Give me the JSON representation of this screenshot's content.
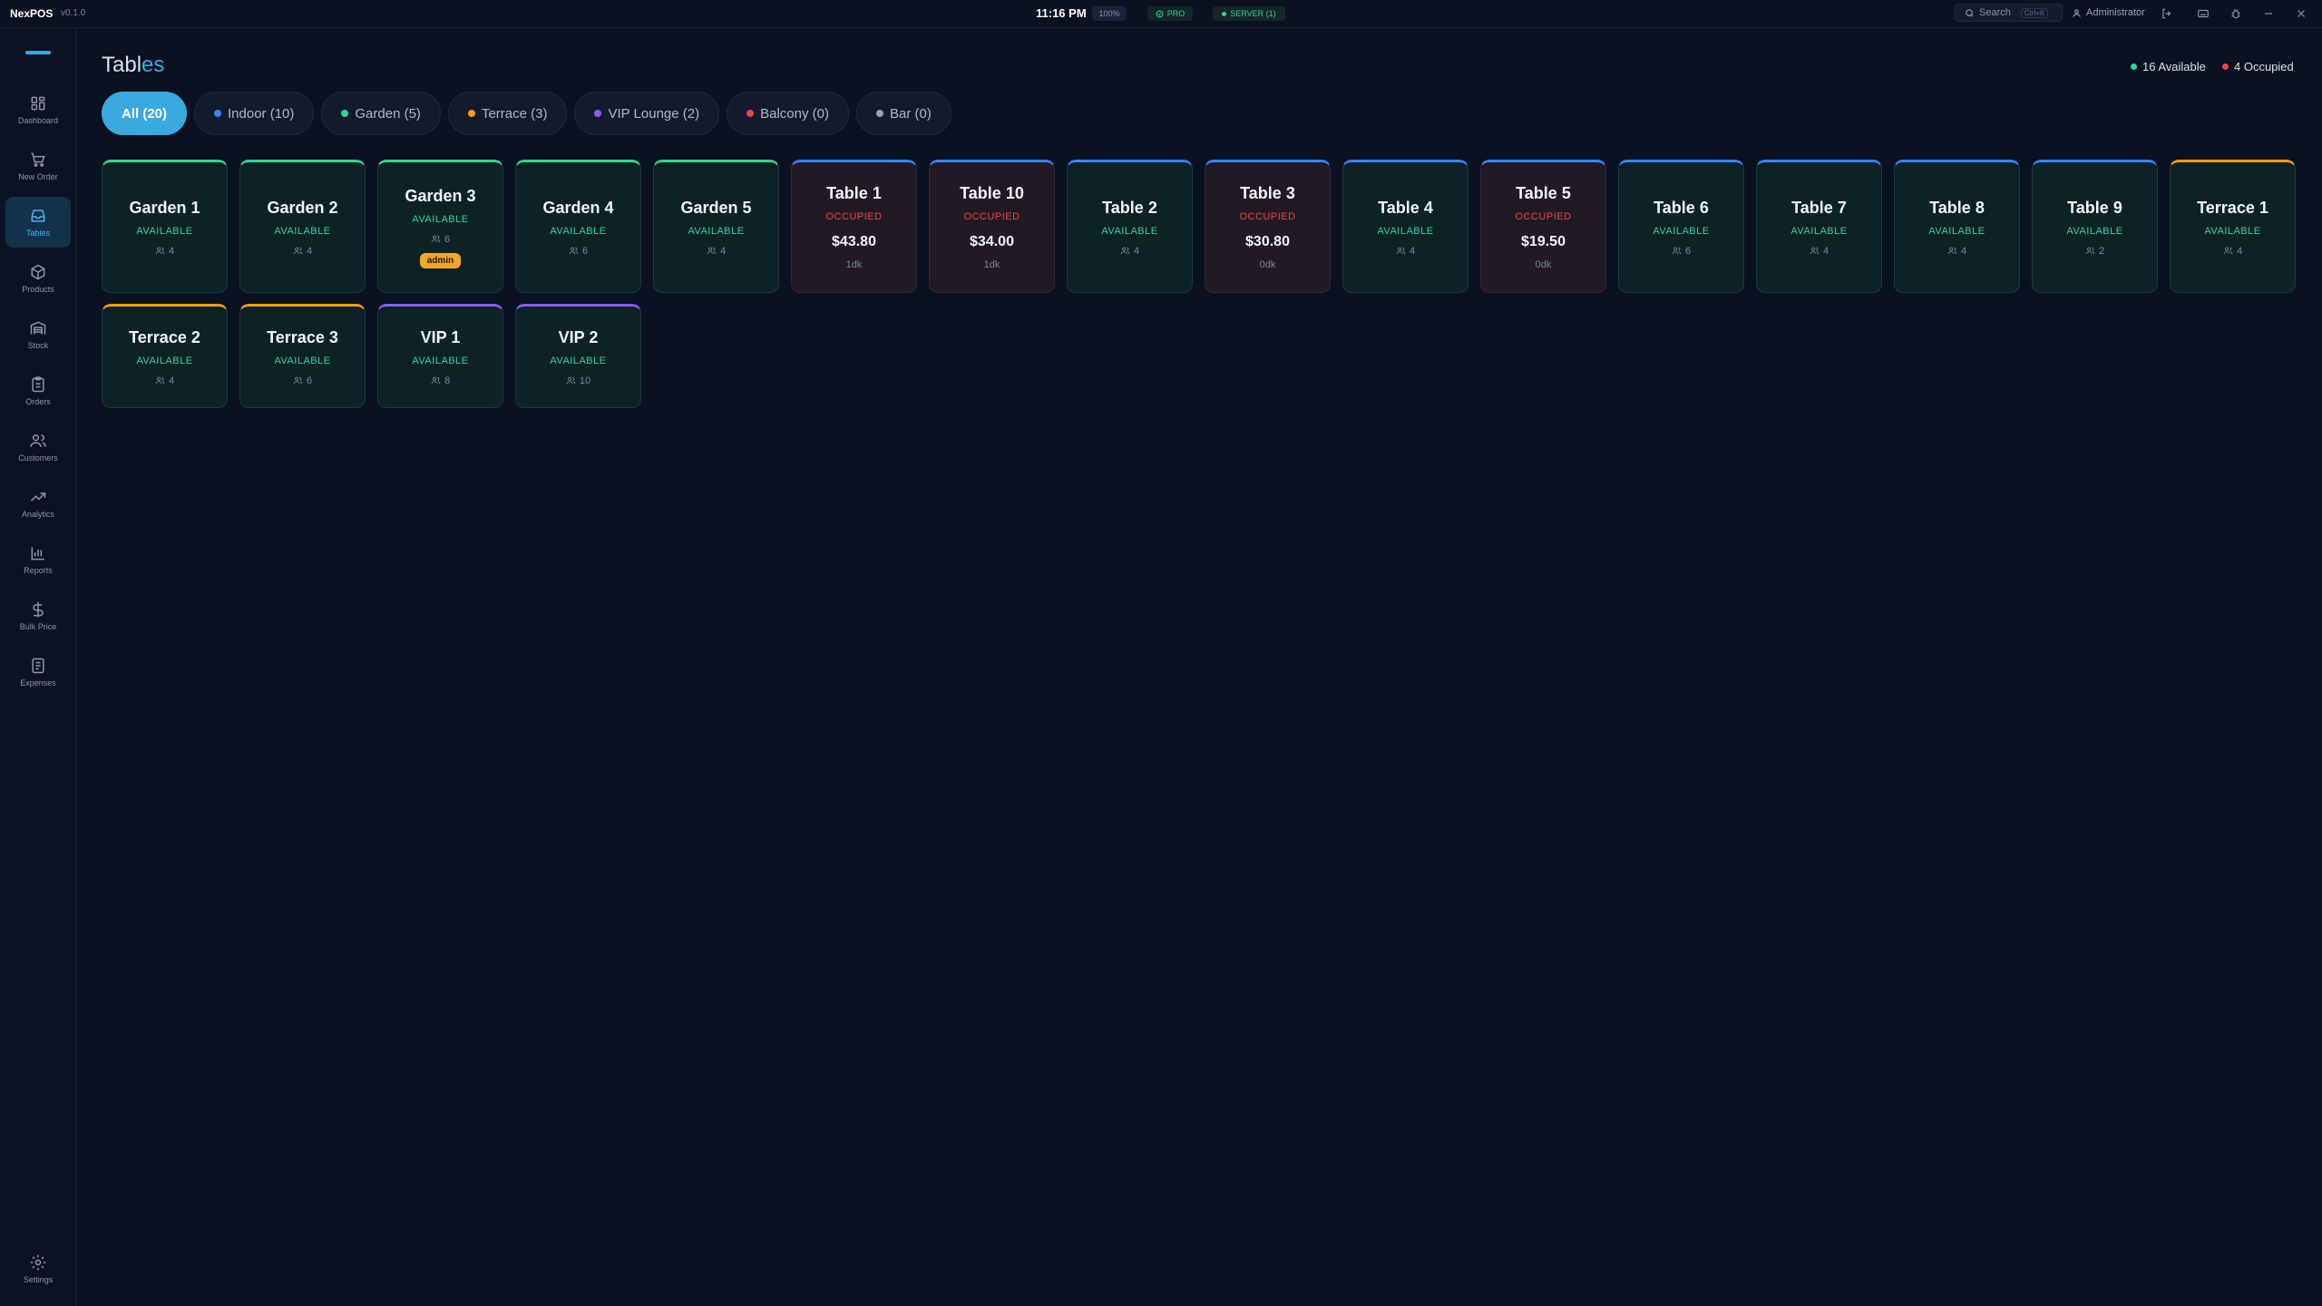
{
  "app": {
    "brand": "NexPOS",
    "version": "v0.1.0",
    "clock": "11:16 PM",
    "zoom": "100%",
    "plan": "PRO",
    "server": "SERVER (1)",
    "search_placeholder": "Search",
    "search_shortcut": "Ctrl+K",
    "user": "Administrator"
  },
  "colors": {
    "accent": "#3aa9df",
    "available": "#34d399",
    "occupied": "#ef4444",
    "indoor": "#3b82f6",
    "garden": "#34d399",
    "terrace": "#f59e0b",
    "vip": "#8b5cf6",
    "balcony": "#ef4444",
    "bar": "#94a3b8"
  },
  "sidebar": {
    "items": [
      {
        "label": "Dashboard",
        "icon": "grid-icon"
      },
      {
        "label": "New Order",
        "icon": "cart-icon"
      },
      {
        "label": "Tables",
        "icon": "tray-icon",
        "active": true
      },
      {
        "label": "Products",
        "icon": "box-icon"
      },
      {
        "label": "Stock",
        "icon": "warehouse-icon"
      },
      {
        "label": "Orders",
        "icon": "clipboard-icon"
      },
      {
        "label": "Customers",
        "icon": "users-icon"
      },
      {
        "label": "Analytics",
        "icon": "trend-icon"
      },
      {
        "label": "Reports",
        "icon": "bar-chart-icon"
      },
      {
        "label": "Bulk Price",
        "icon": "dollar-icon"
      },
      {
        "label": "Expenses",
        "icon": "receipt-icon"
      }
    ],
    "settings_label": "Settings"
  },
  "page": {
    "title_main": "Tabl",
    "title_accent": "es",
    "available_summary": "16 Available",
    "occupied_summary": "4 Occupied"
  },
  "tabs": [
    {
      "label": "All (20)",
      "active": true,
      "color": ""
    },
    {
      "label": "Indoor (10)",
      "color": "#3b82f6"
    },
    {
      "label": "Garden (5)",
      "color": "#34d399"
    },
    {
      "label": "Terrace (3)",
      "color": "#f59e0b"
    },
    {
      "label": "VIP Lounge (2)",
      "color": "#8b5cf6"
    },
    {
      "label": "Balcony (0)",
      "color": "#ef4444"
    },
    {
      "label": "Bar (0)",
      "color": "#94a3b8"
    }
  ],
  "tables": [
    {
      "name": "Garden 1",
      "status": "AVAILABLE",
      "seats": "4",
      "zone": "garden"
    },
    {
      "name": "Garden 2",
      "status": "AVAILABLE",
      "seats": "4",
      "zone": "garden"
    },
    {
      "name": "Garden 3",
      "status": "AVAILABLE",
      "seats": "6",
      "zone": "garden",
      "tag": "admin"
    },
    {
      "name": "Garden 4",
      "status": "AVAILABLE",
      "seats": "6",
      "zone": "garden"
    },
    {
      "name": "Garden 5",
      "status": "AVAILABLE",
      "seats": "4",
      "zone": "garden"
    },
    {
      "name": "Table 1",
      "status": "OCCUPIED",
      "amount": "$43.80",
      "time": "1dk",
      "zone": "indoor"
    },
    {
      "name": "Table 10",
      "status": "OCCUPIED",
      "amount": "$34.00",
      "time": "1dk",
      "zone": "indoor"
    },
    {
      "name": "Table 2",
      "status": "AVAILABLE",
      "seats": "4",
      "zone": "indoor"
    },
    {
      "name": "Table 3",
      "status": "OCCUPIED",
      "amount": "$30.80",
      "time": "0dk",
      "zone": "indoor"
    },
    {
      "name": "Table 4",
      "status": "AVAILABLE",
      "seats": "4",
      "zone": "indoor"
    },
    {
      "name": "Table 5",
      "status": "OCCUPIED",
      "amount": "$19.50",
      "time": "0dk",
      "zone": "indoor"
    },
    {
      "name": "Table 6",
      "status": "AVAILABLE",
      "seats": "6",
      "zone": "indoor"
    },
    {
      "name": "Table 7",
      "status": "AVAILABLE",
      "seats": "4",
      "zone": "indoor"
    },
    {
      "name": "Table 8",
      "status": "AVAILABLE",
      "seats": "4",
      "zone": "indoor"
    },
    {
      "name": "Table 9",
      "status": "AVAILABLE",
      "seats": "2",
      "zone": "indoor"
    },
    {
      "name": "Terrace 1",
      "status": "AVAILABLE",
      "seats": "4",
      "zone": "terrace"
    },
    {
      "name": "Terrace 2",
      "status": "AVAILABLE",
      "seats": "4",
      "zone": "terrace"
    },
    {
      "name": "Terrace 3",
      "status": "AVAILABLE",
      "seats": "6",
      "zone": "terrace"
    },
    {
      "name": "VIP 1",
      "status": "AVAILABLE",
      "seats": "8",
      "zone": "vip"
    },
    {
      "name": "VIP 2",
      "status": "AVAILABLE",
      "seats": "10",
      "zone": "vip"
    }
  ]
}
